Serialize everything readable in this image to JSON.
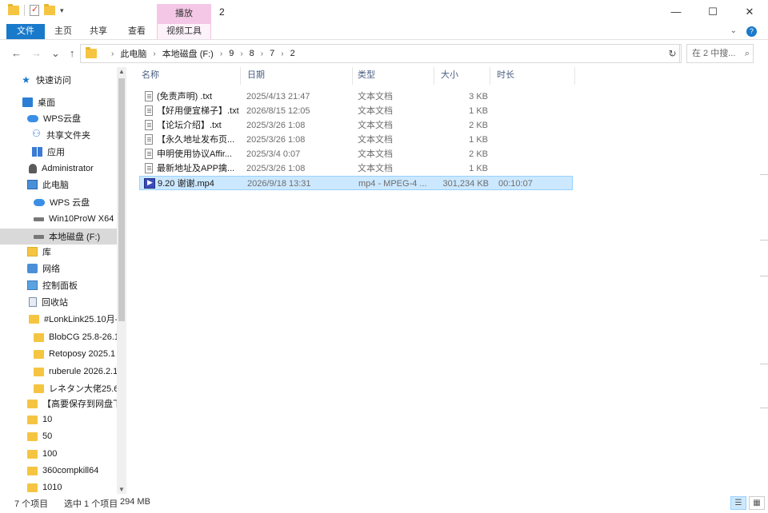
{
  "window": {
    "title": "2",
    "context_tab": "播放",
    "controls": {
      "minimize": "—",
      "maximize": "☐",
      "close": "✕"
    }
  },
  "ribbon": {
    "tabs": [
      "文件",
      "主页",
      "共享",
      "查看",
      "视频工具"
    ],
    "expand_icon": "chevron-down-icon",
    "help_icon": "?"
  },
  "address": {
    "back": "←",
    "forward": "→",
    "recent": "⌄",
    "up": "↑",
    "crumbs": [
      "此电脑",
      "本地磁盘 (F:)",
      "9",
      "8",
      "7",
      "2"
    ],
    "refresh": "↻",
    "search_placeholder": "在 2 中搜..."
  },
  "navpane": {
    "items": [
      {
        "label": "快速访问",
        "icon": "star-icon"
      },
      {
        "label": "桌面",
        "icon": "desktop-icon"
      },
      {
        "label": "WPS云盘",
        "icon": "cloud-icon"
      },
      {
        "label": "共享文件夹",
        "icon": "share-icon"
      },
      {
        "label": "应用",
        "icon": "apps-icon"
      },
      {
        "label": "Administrator",
        "icon": "user-icon"
      },
      {
        "label": "此电脑",
        "icon": "pc-icon"
      },
      {
        "label": "WPS 云盘",
        "icon": "cloud-icon"
      },
      {
        "label": "Win10ProW X64",
        "icon": "drive-icon"
      },
      {
        "label": "本地磁盘 (F:)",
        "icon": "drive-icon",
        "selected": true
      },
      {
        "label": "库",
        "icon": "library-icon"
      },
      {
        "label": "网络",
        "icon": "network-icon"
      },
      {
        "label": "控制面板",
        "icon": "control-panel-icon"
      },
      {
        "label": "回收站",
        "icon": "recycle-bin-icon"
      },
      {
        "label": "#LonkLink25.10月-",
        "icon": "folder-icon"
      },
      {
        "label": "BlobCG 25.8-26.1",
        "icon": "folder-icon"
      },
      {
        "label": "Retoposy 2025.1",
        "icon": "folder-icon"
      },
      {
        "label": "ruberule 2026.2.1",
        "icon": "folder-icon"
      },
      {
        "label": "レネタン大佬25.6",
        "icon": "folder-icon"
      },
      {
        "label": "【高要保存到网盘下",
        "icon": "folder-icon"
      },
      {
        "label": "10",
        "icon": "folder-icon"
      },
      {
        "label": "50",
        "icon": "folder-icon"
      },
      {
        "label": "100",
        "icon": "folder-icon"
      },
      {
        "label": "360compkill64",
        "icon": "folder-icon"
      },
      {
        "label": "1010",
        "icon": "folder-icon"
      }
    ]
  },
  "columns": [
    "名称",
    "日期",
    "类型",
    "大小",
    "时长"
  ],
  "files": [
    {
      "name": "(免责声明) .txt",
      "date": "2025/4/13 21:47",
      "type": "文本文档",
      "size": "3 KB",
      "duration": "",
      "icon": "text-file-icon"
    },
    {
      "name": "【好用便宜梯子】.txt",
      "date": "2026/8/15 12:05",
      "type": "文本文档",
      "size": "1 KB",
      "duration": "",
      "icon": "text-file-icon"
    },
    {
      "name": "【论坛介绍】.txt",
      "date": "2025/3/26 1:08",
      "type": "文本文档",
      "size": "2 KB",
      "duration": "",
      "icon": "text-file-icon"
    },
    {
      "name": "【永久地址发布页...",
      "date": "2025/3/26 1:08",
      "type": "文本文档",
      "size": "1 KB",
      "duration": "",
      "icon": "text-file-icon"
    },
    {
      "name": "申明使用协议Affir...",
      "date": "2025/3/4 0:07",
      "type": "文本文档",
      "size": "2 KB",
      "duration": "",
      "icon": "text-file-icon"
    },
    {
      "name": "最新地址及APP擒...",
      "date": "2025/3/26 1:08",
      "type": "文本文档",
      "size": "1 KB",
      "duration": "",
      "icon": "text-file-icon"
    },
    {
      "name": "9.20 谢谢.mp4",
      "date": "2026/9/18 13:31",
      "type": "mp4 - MPEG-4 ...",
      "size": "301,234 KB",
      "duration": "00:10:07",
      "icon": "video-file-icon",
      "selected": true
    }
  ],
  "status": {
    "count": "7 个项目",
    "selected": "选中 1 个项目",
    "size": "294 MB"
  }
}
